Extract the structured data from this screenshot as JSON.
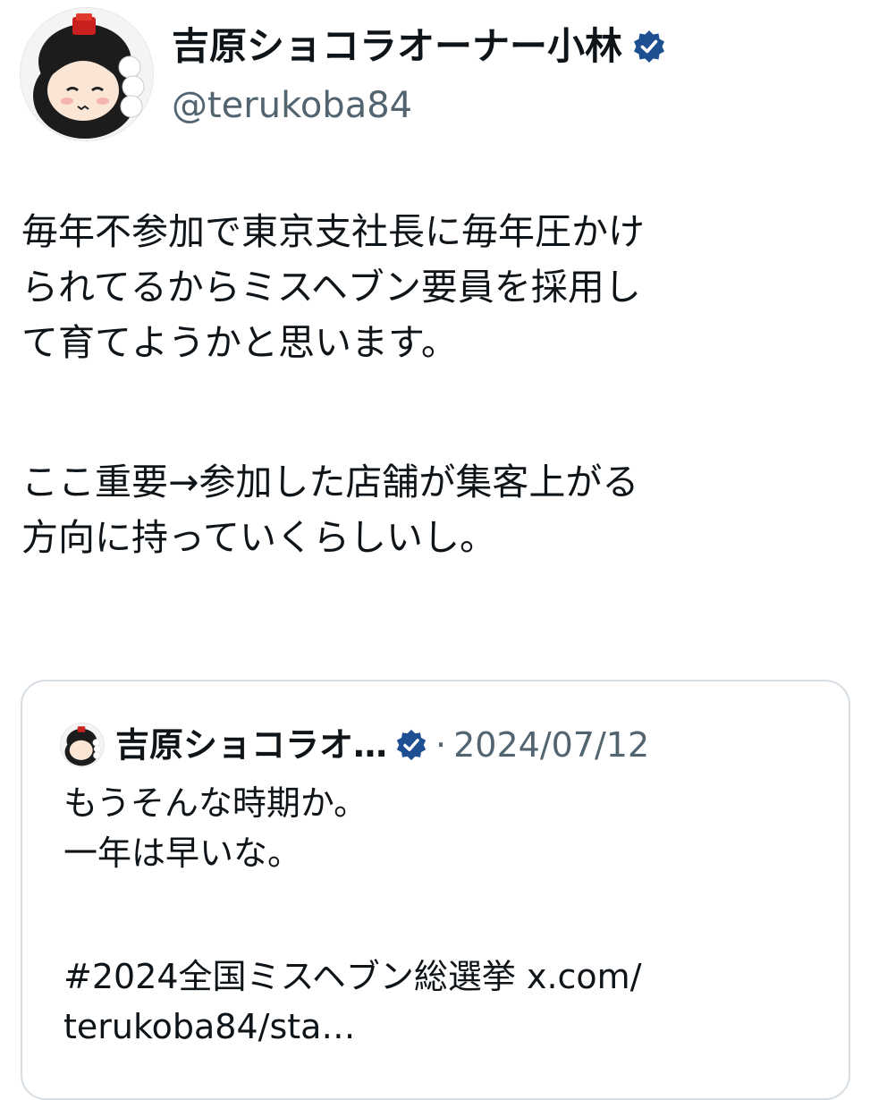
{
  "author": {
    "display_name": "吉原ショコラオーナー小林",
    "handle": "@terukoba84",
    "verified_icon": "verified-badge-icon",
    "verified_color": "#1d4f91"
  },
  "tweet": {
    "lines_paragraph1": [
      "毎年不参加で東京支社長に毎年圧かけ",
      "られてるからミスヘブン要員を採用し",
      "て育てようかと思います。"
    ],
    "lines_paragraph2": [
      "ここ重要→参加した店舗が集客上がる",
      "方向に持っていくらしいし。"
    ]
  },
  "quoted_tweet": {
    "display_name": "吉原ショコラオ…",
    "separator": "·",
    "date": "2024/07/12",
    "lines_paragraph1": [
      "もうそんな時期か。",
      "一年は早いな。"
    ],
    "lines_paragraph2": [
      "#2024全国ミスヘブン総選挙 x.com/",
      "terukoba84/sta…"
    ]
  },
  "colors": {
    "text_primary": "#0f1419",
    "text_secondary": "#536471",
    "card_border": "#d6dde3"
  }
}
